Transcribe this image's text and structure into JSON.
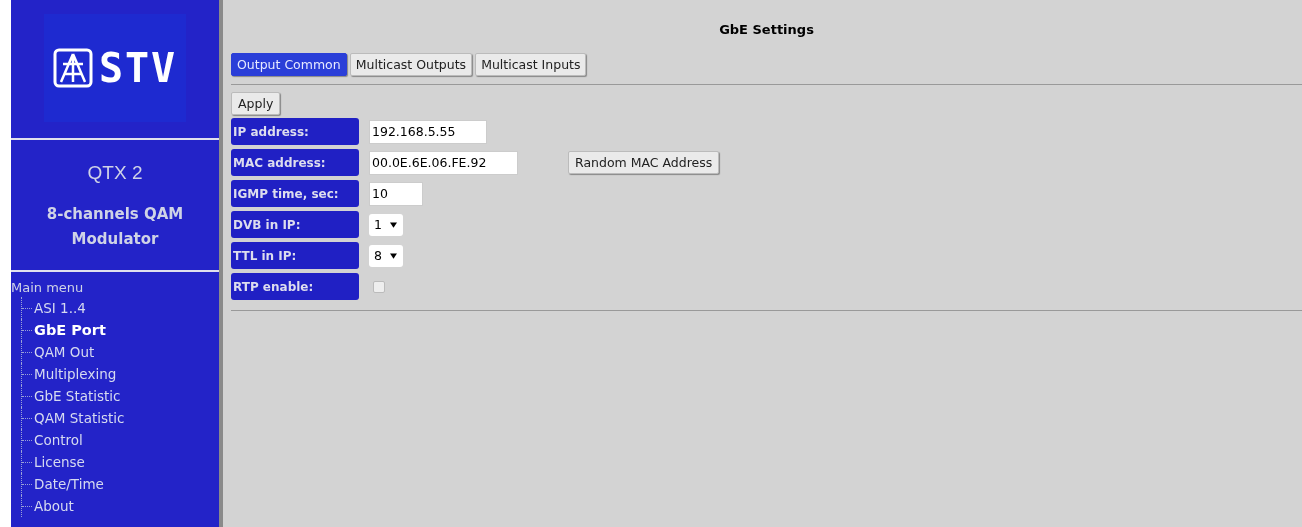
{
  "sidebar": {
    "logo_text": "STV",
    "product": "QTX 2",
    "description": "8-channels QAM Modulator",
    "menu_title": "Main menu",
    "items": [
      {
        "label": "ASI 1..4",
        "selected": false
      },
      {
        "label": "GbE Port",
        "selected": true
      },
      {
        "label": "QAM Out",
        "selected": false
      },
      {
        "label": "Multiplexing",
        "selected": false
      },
      {
        "label": "GbE Statistic",
        "selected": false
      },
      {
        "label": "QAM Statistic",
        "selected": false
      },
      {
        "label": "Control",
        "selected": false
      },
      {
        "label": "License",
        "selected": false
      },
      {
        "label": "Date/Time",
        "selected": false
      },
      {
        "label": "About",
        "selected": false
      }
    ]
  },
  "page_title": "GbE Settings",
  "tabs": [
    {
      "label": "Output Common",
      "selected": true
    },
    {
      "label": "Multicast Outputs",
      "selected": false
    },
    {
      "label": "Multicast Inputs",
      "selected": false
    }
  ],
  "apply_button": "Apply",
  "fields": [
    {
      "kind": "text",
      "label": "IP address:",
      "value": "192.168.5.55"
    },
    {
      "kind": "text",
      "label": "MAC address:",
      "value": "00.0E.6E.06.FE.92",
      "button": "Random MAC Address"
    },
    {
      "kind": "text",
      "label": "IGMP time, sec:",
      "value": "10"
    },
    {
      "kind": "select",
      "label": "DVB in IP:",
      "value": "1"
    },
    {
      "kind": "select",
      "label": "TTL in IP:",
      "value": "8"
    },
    {
      "kind": "checkbox",
      "label": "RTP enable:",
      "checked": false
    }
  ]
}
